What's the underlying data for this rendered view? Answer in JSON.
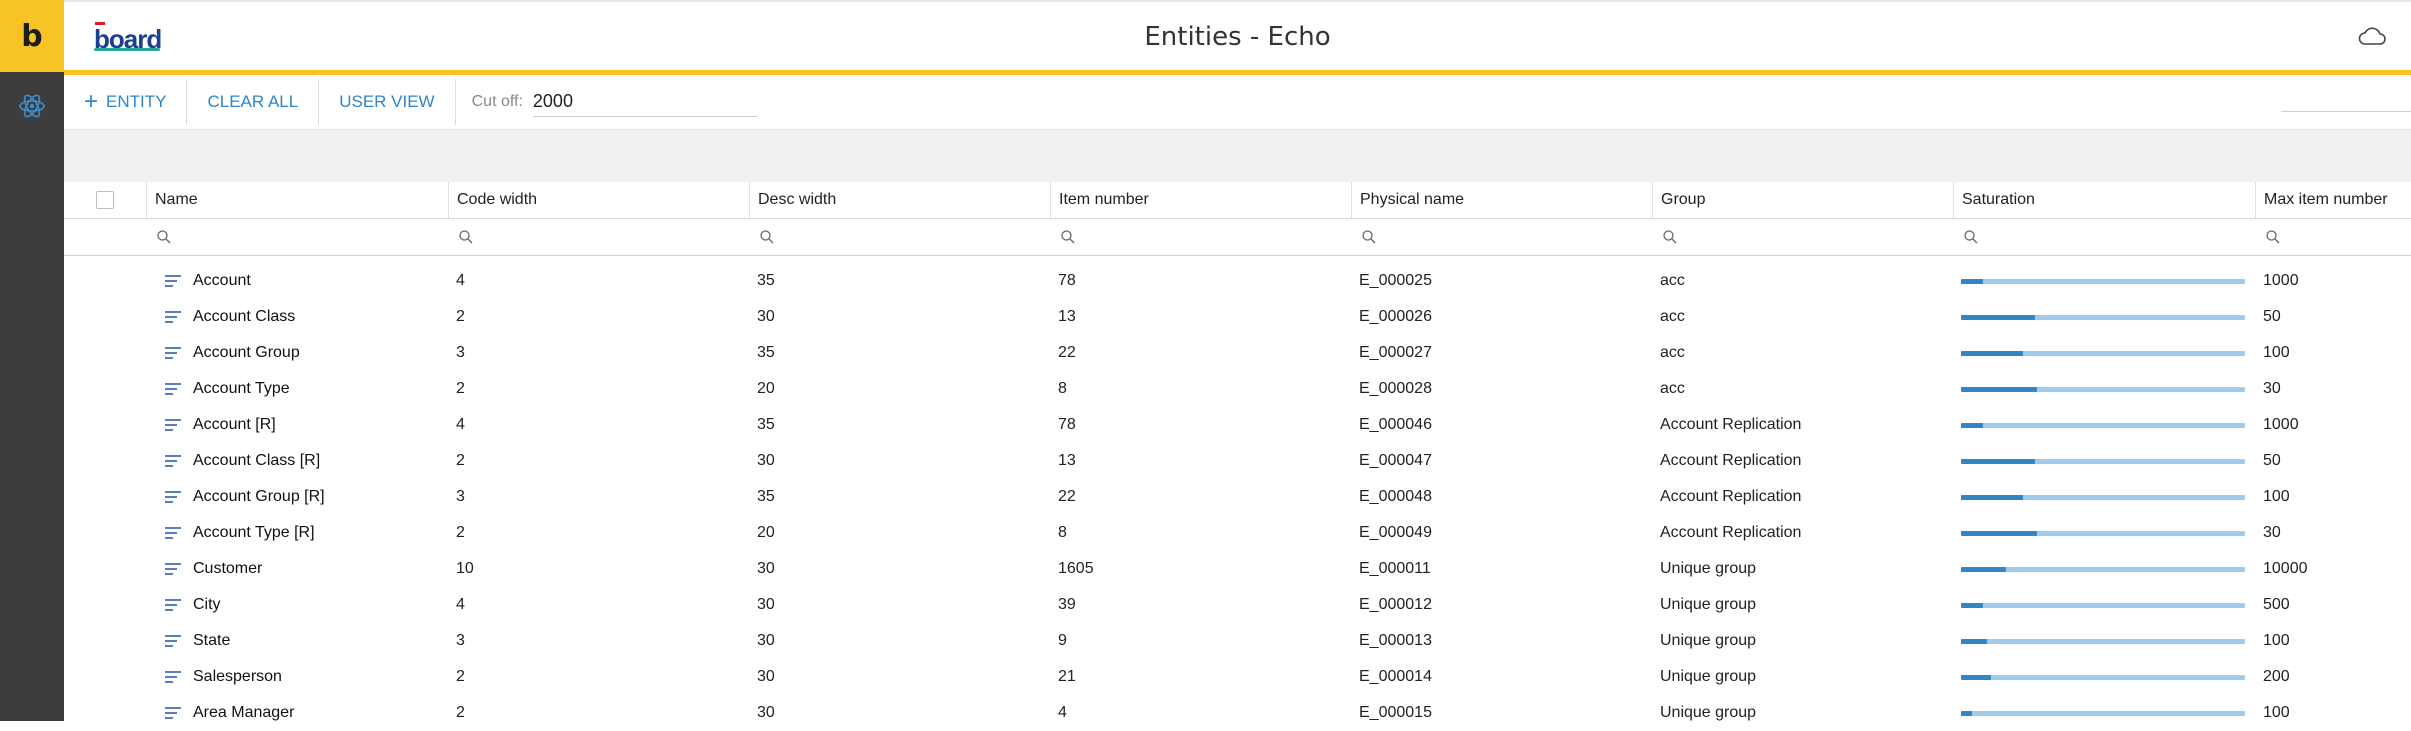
{
  "app": {
    "rail_logo": "b",
    "brand_text": "board",
    "title": "Entities - Echo"
  },
  "toolbar": {
    "add_entity_label": "ENTITY",
    "clear_all_label": "CLEAR ALL",
    "user_view_label": "USER VIEW",
    "cutoff_label": "Cut off:",
    "cutoff_value": "2000"
  },
  "columns": [
    "Name",
    "Code width",
    "Desc width",
    "Item number",
    "Physical name",
    "Group",
    "Saturation",
    "Max item number"
  ],
  "rows": [
    {
      "name": "Account",
      "code_width": "4",
      "desc_width": "35",
      "item_number": "78",
      "physical_name": "E_000025",
      "group": "acc",
      "saturation": 0.078,
      "max_item_number": "1000"
    },
    {
      "name": "Account Class",
      "code_width": "2",
      "desc_width": "30",
      "item_number": "13",
      "physical_name": "E_000026",
      "group": "acc",
      "saturation": 0.26,
      "max_item_number": "50"
    },
    {
      "name": "Account Group",
      "code_width": "3",
      "desc_width": "35",
      "item_number": "22",
      "physical_name": "E_000027",
      "group": "acc",
      "saturation": 0.22,
      "max_item_number": "100"
    },
    {
      "name": "Account Type",
      "code_width": "2",
      "desc_width": "20",
      "item_number": "8",
      "physical_name": "E_000028",
      "group": "acc",
      "saturation": 0.267,
      "max_item_number": "30"
    },
    {
      "name": "Account [R]",
      "code_width": "4",
      "desc_width": "35",
      "item_number": "78",
      "physical_name": "E_000046",
      "group": "Account Replication",
      "saturation": 0.078,
      "max_item_number": "1000"
    },
    {
      "name": "Account Class [R]",
      "code_width": "2",
      "desc_width": "30",
      "item_number": "13",
      "physical_name": "E_000047",
      "group": "Account Replication",
      "saturation": 0.26,
      "max_item_number": "50"
    },
    {
      "name": "Account Group [R]",
      "code_width": "3",
      "desc_width": "35",
      "item_number": "22",
      "physical_name": "E_000048",
      "group": "Account Replication",
      "saturation": 0.22,
      "max_item_number": "100"
    },
    {
      "name": "Account Type [R]",
      "code_width": "2",
      "desc_width": "20",
      "item_number": "8",
      "physical_name": "E_000049",
      "group": "Account Replication",
      "saturation": 0.267,
      "max_item_number": "30"
    },
    {
      "name": "Customer",
      "code_width": "10",
      "desc_width": "30",
      "item_number": "1605",
      "physical_name": "E_000011",
      "group": "Unique group",
      "saturation": 0.16,
      "max_item_number": "10000"
    },
    {
      "name": "City",
      "code_width": "4",
      "desc_width": "30",
      "item_number": "39",
      "physical_name": "E_000012",
      "group": "Unique group",
      "saturation": 0.078,
      "max_item_number": "500"
    },
    {
      "name": "State",
      "code_width": "3",
      "desc_width": "30",
      "item_number": "9",
      "physical_name": "E_000013",
      "group": "Unique group",
      "saturation": 0.09,
      "max_item_number": "100"
    },
    {
      "name": "Salesperson",
      "code_width": "2",
      "desc_width": "30",
      "item_number": "21",
      "physical_name": "E_000014",
      "group": "Unique group",
      "saturation": 0.105,
      "max_item_number": "200"
    },
    {
      "name": "Area Manager",
      "code_width": "2",
      "desc_width": "30",
      "item_number": "4",
      "physical_name": "E_000015",
      "group": "Unique group",
      "saturation": 0.04,
      "max_item_number": "100"
    }
  ]
}
